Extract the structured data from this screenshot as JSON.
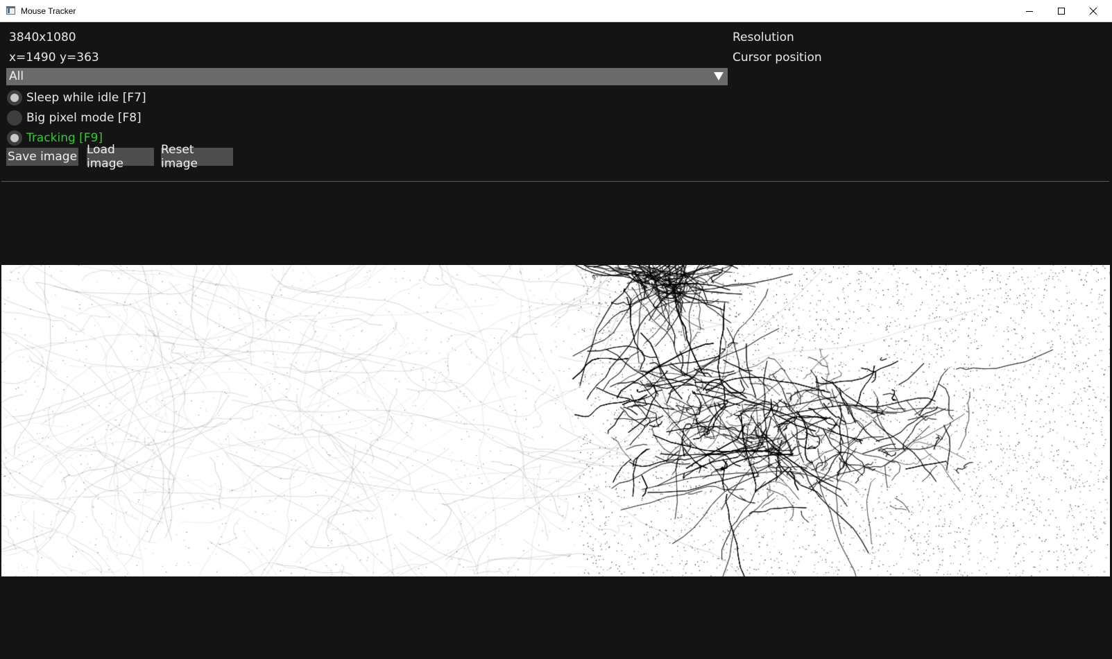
{
  "window": {
    "title": "Mouse Tracker",
    "controls": [
      "minimize-icon",
      "maximize-icon",
      "close-icon"
    ]
  },
  "info": {
    "resolution_value": "3840x1080",
    "resolution_label": "Resolution",
    "cursor_value": "x=1490 y=363",
    "cursor_label": "Cursor position"
  },
  "dropdown": {
    "selected": "All",
    "arrow_icon": "triangle-down-icon"
  },
  "options": [
    {
      "label": "Sleep while idle [F7]",
      "enabled": true,
      "color": "#e8e8e8"
    },
    {
      "label": "Big pixel mode [F8]",
      "enabled": false,
      "color": "#e8e8e8"
    },
    {
      "label": "Tracking [F9]",
      "enabled": true,
      "color": "#2ecc2e"
    }
  ],
  "buttons": {
    "save": "Save image",
    "load": "Load image",
    "reset": "Reset image"
  },
  "colors": {
    "background": "#141414",
    "button": "#4e4e4e",
    "dropdown": "#6a6a6a",
    "tracking_active": "#2ecc2e",
    "heatmap_bg": "#ffffff",
    "heatmap_ink": "#000000"
  }
}
